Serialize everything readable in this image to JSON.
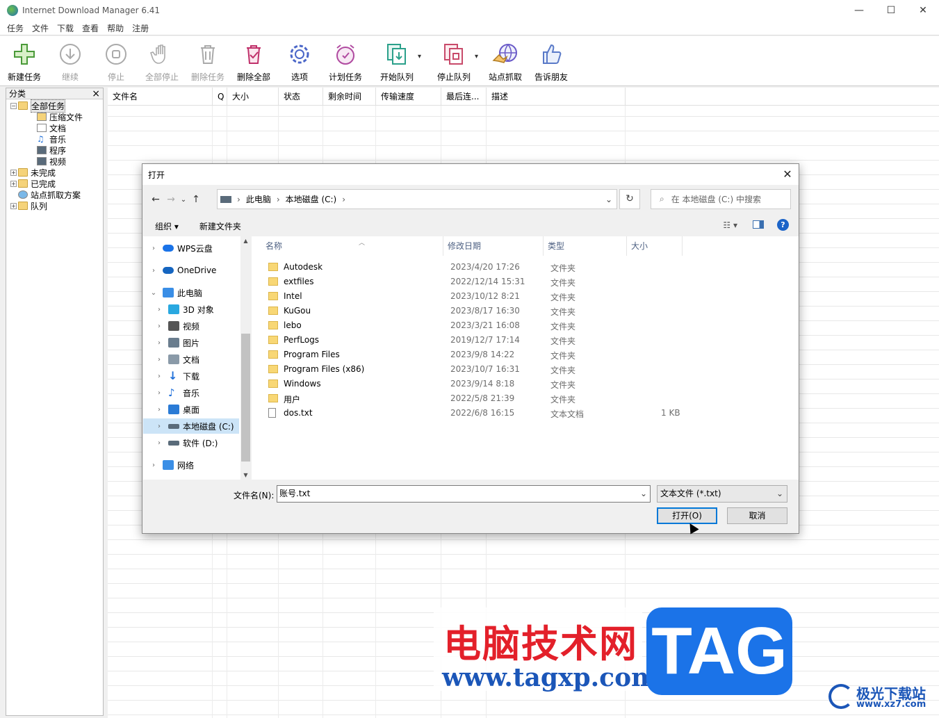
{
  "window": {
    "title": "Internet Download Manager 6.41",
    "minimize": "—",
    "maximize": "☐",
    "close": "✕"
  },
  "menu": [
    "任务",
    "文件",
    "下载",
    "查看",
    "帮助",
    "注册"
  ],
  "toolbar": [
    {
      "label": "新建任务",
      "icon": "plus-icon",
      "enabled": true
    },
    {
      "label": "继续",
      "icon": "resume-icon",
      "enabled": false
    },
    {
      "label": "停止",
      "icon": "stop-icon",
      "enabled": false
    },
    {
      "label": "全部停止",
      "icon": "hand-icon",
      "enabled": false
    },
    {
      "label": "删除任务",
      "icon": "trash-icon",
      "enabled": false
    },
    {
      "label": "删除全部",
      "icon": "trash-all-icon",
      "enabled": true
    },
    {
      "label": "选项",
      "icon": "gear-icon",
      "enabled": true
    },
    {
      "label": "计划任务",
      "icon": "clock-icon",
      "enabled": true
    },
    {
      "label": "开始队列",
      "icon": "start-queue-icon",
      "enabled": true
    },
    {
      "label": "停止队列",
      "icon": "stop-queue-icon",
      "enabled": true
    },
    {
      "label": "站点抓取",
      "icon": "globe-icon",
      "enabled": true
    },
    {
      "label": "告诉朋友",
      "icon": "thumbs-up-icon",
      "enabled": true
    }
  ],
  "sidebar": {
    "header": "分类",
    "close": "×",
    "tree": [
      {
        "label": "全部任务",
        "level": 0,
        "expander": "⊟",
        "icon": "folder-open-icon"
      },
      {
        "label": "压缩文件",
        "level": 1,
        "icon": "zip-icon"
      },
      {
        "label": "文档",
        "level": 1,
        "icon": "document-icon"
      },
      {
        "label": "音乐",
        "level": 1,
        "icon": "music-icon"
      },
      {
        "label": "程序",
        "level": 1,
        "icon": "program-icon"
      },
      {
        "label": "视频",
        "level": 1,
        "icon": "video-icon"
      },
      {
        "label": "未完成",
        "level": 0,
        "expander": "⊞",
        "icon": "folder-unfinished-icon"
      },
      {
        "label": "已完成",
        "level": 0,
        "expander": "⊞",
        "icon": "folder-finished-icon"
      },
      {
        "label": "站点抓取方案",
        "level": 0,
        "icon": "grabber-icon"
      },
      {
        "label": "队列",
        "level": 0,
        "expander": "⊞",
        "icon": "folder-queue-icon"
      }
    ]
  },
  "list_columns": [
    "文件名",
    "Q",
    "大小",
    "状态",
    "剩余时间",
    "传输速度",
    "最后连...",
    "描述"
  ],
  "dialog": {
    "title": "打开",
    "close": "✕",
    "breadcrumb": [
      "此电脑",
      "本地磁盘 (C:)"
    ],
    "search_placeholder": "在 本地磁盘 (C:) 中搜索",
    "organize": "组织 ▾",
    "new_folder": "新建文件夹",
    "help": "?",
    "nav": [
      {
        "label": "WPS云盘",
        "indent": 0,
        "icon": "cloud-icon",
        "color": "#1a73e8"
      },
      {
        "label": "OneDrive",
        "indent": 0,
        "icon": "onedrive-icon",
        "color": "#1565c0"
      },
      {
        "label": "此电脑",
        "indent": 0,
        "icon": "pc-icon",
        "color": "#3a8ee6",
        "expanded": true
      },
      {
        "label": "3D 对象",
        "indent": 1,
        "icon": "cube-icon",
        "color": "#29a8e0"
      },
      {
        "label": "视频",
        "indent": 1,
        "icon": "video-icon",
        "color": "#555555"
      },
      {
        "label": "图片",
        "indent": 1,
        "icon": "image-icon",
        "color": "#6a7d8e"
      },
      {
        "label": "文档",
        "indent": 1,
        "icon": "document-icon",
        "color": "#8a9aa8"
      },
      {
        "label": "下载",
        "indent": 1,
        "icon": "download-icon",
        "color": "#1e6fd9"
      },
      {
        "label": "音乐",
        "indent": 1,
        "icon": "music-icon",
        "color": "#1e6fd9"
      },
      {
        "label": "桌面",
        "indent": 1,
        "icon": "desktop-icon",
        "color": "#2a7bd6"
      },
      {
        "label": "本地磁盘 (C:)",
        "indent": 1,
        "icon": "drive-icon",
        "color": "#5a6b7a",
        "selected": true
      },
      {
        "label": "软件 (D:)",
        "indent": 1,
        "icon": "drive-icon",
        "color": "#5a6b7a"
      },
      {
        "label": "网络",
        "indent": 0,
        "icon": "network-icon",
        "color": "#3a8ee6"
      }
    ],
    "columns": [
      "名称",
      "修改日期",
      "类型",
      "大小"
    ],
    "files": [
      {
        "name": "Autodesk",
        "date": "2023/4/20 17:26",
        "type": "文件夹",
        "size": "",
        "kind": "folder"
      },
      {
        "name": "extfiles",
        "date": "2022/12/14 15:31",
        "type": "文件夹",
        "size": "",
        "kind": "folder"
      },
      {
        "name": "Intel",
        "date": "2023/10/12 8:21",
        "type": "文件夹",
        "size": "",
        "kind": "folder"
      },
      {
        "name": "KuGou",
        "date": "2023/8/17 16:30",
        "type": "文件夹",
        "size": "",
        "kind": "folder"
      },
      {
        "name": "lebo",
        "date": "2023/3/21 16:08",
        "type": "文件夹",
        "size": "",
        "kind": "folder"
      },
      {
        "name": "PerfLogs",
        "date": "2019/12/7 17:14",
        "type": "文件夹",
        "size": "",
        "kind": "folder"
      },
      {
        "name": "Program Files",
        "date": "2023/9/8 14:22",
        "type": "文件夹",
        "size": "",
        "kind": "folder"
      },
      {
        "name": "Program Files (x86)",
        "date": "2023/10/7 16:31",
        "type": "文件夹",
        "size": "",
        "kind": "folder"
      },
      {
        "name": "Windows",
        "date": "2023/9/14 8:18",
        "type": "文件夹",
        "size": "",
        "kind": "folder"
      },
      {
        "name": "用户",
        "date": "2022/5/8 21:39",
        "type": "文件夹",
        "size": "",
        "kind": "folder"
      },
      {
        "name": "dos.txt",
        "date": "2022/6/8 16:15",
        "type": "文本文档",
        "size": "1 KB",
        "kind": "file"
      }
    ],
    "filename_label": "文件名(N):",
    "filename_value": "账号.txt",
    "filetype": "文本文件 (*.txt)",
    "open_button": "打开(O)",
    "cancel_button": "取消"
  },
  "watermark": {
    "cn": "电脑技术网",
    "url": "www.tagxp.com",
    "tag": "TAG",
    "site2_title": "极光下载站",
    "site2_url": "www.xz7.com"
  }
}
